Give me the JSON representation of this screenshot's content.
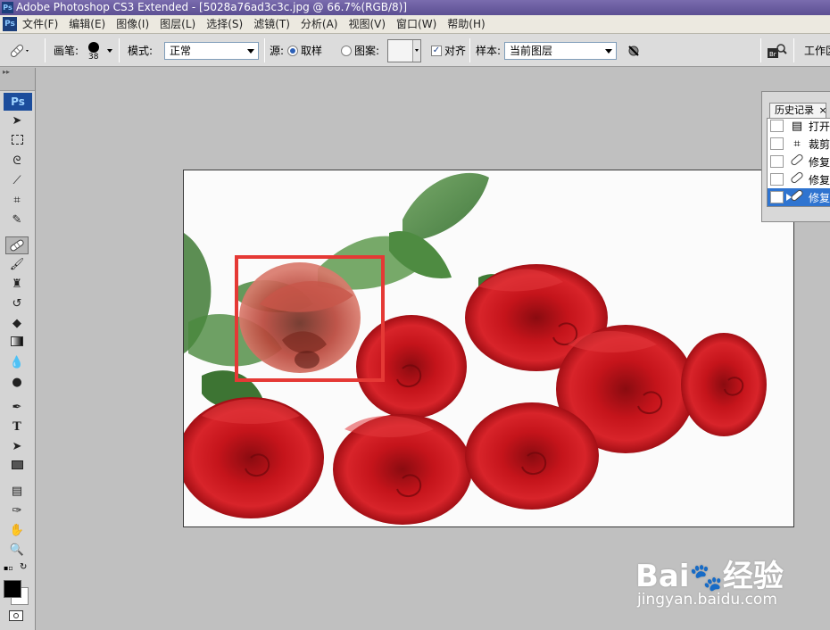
{
  "window": {
    "title": "Adobe Photoshop CS3 Extended - [5028a76ad3c3c.jpg @ 66.7%(RGB/8)]",
    "app_badge": "Ps"
  },
  "menu": {
    "items": [
      "文件(F)",
      "编辑(E)",
      "图像(I)",
      "图层(L)",
      "选择(S)",
      "滤镜(T)",
      "分析(A)",
      "视图(V)",
      "窗口(W)",
      "帮助(H)"
    ]
  },
  "options": {
    "brush_label": "画笔:",
    "brush_size": "38",
    "mode_label": "模式:",
    "mode_value": "正常",
    "source_label": "源:",
    "sampled_label": "取样",
    "pattern_label": "图案:",
    "aligned_label": "对齐",
    "aligned_checked": "✓",
    "sample_label": "样本:",
    "sample_value": "当前图层",
    "workspace_label": "工作区"
  },
  "toolbox": {
    "badge": "Ps",
    "collapse_glyph": "▸▸",
    "active_tool": "healing-brush"
  },
  "history": {
    "tab_label": "历史记录",
    "close_glyph": "×",
    "rows": [
      {
        "icon": "document-icon",
        "label": "打开"
      },
      {
        "icon": "crop-icon",
        "label": "裁剪"
      },
      {
        "icon": "patch-bandage-icon",
        "label": "修复"
      },
      {
        "icon": "patch-bandage-icon",
        "label": "修复"
      },
      {
        "icon": "patch-bandage-icon",
        "label": "修复"
      }
    ],
    "selected_index": 4
  },
  "watermark": {
    "text": "Bai",
    "text2": "经验",
    "url": "jingyan.baidu.com"
  },
  "colors": {
    "title_bar": "#6b5ea3",
    "selection": "#2f74d0",
    "highlight_box": "#e53935",
    "workspace": "#c0c0c0"
  }
}
